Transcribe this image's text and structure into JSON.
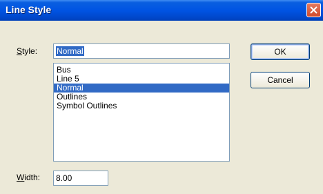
{
  "window": {
    "title": "Line Style"
  },
  "style_field": {
    "label_underline": "S",
    "label_rest": "tyle:",
    "value": "Normal"
  },
  "style_list": {
    "items": [
      "Bus",
      "Line 5",
      "Normal",
      "Outlines",
      "Symbol Outlines"
    ],
    "selected_index": 2
  },
  "width_field": {
    "label_underline": "W",
    "label_rest": "idth:",
    "value": "8.00"
  },
  "buttons": {
    "ok": "OK",
    "cancel": "Cancel"
  },
  "colors": {
    "title_bar": "#0054e3",
    "selection": "#316ac5",
    "close_button": "#d24b2c",
    "dialog_bg": "#ece9d8"
  }
}
